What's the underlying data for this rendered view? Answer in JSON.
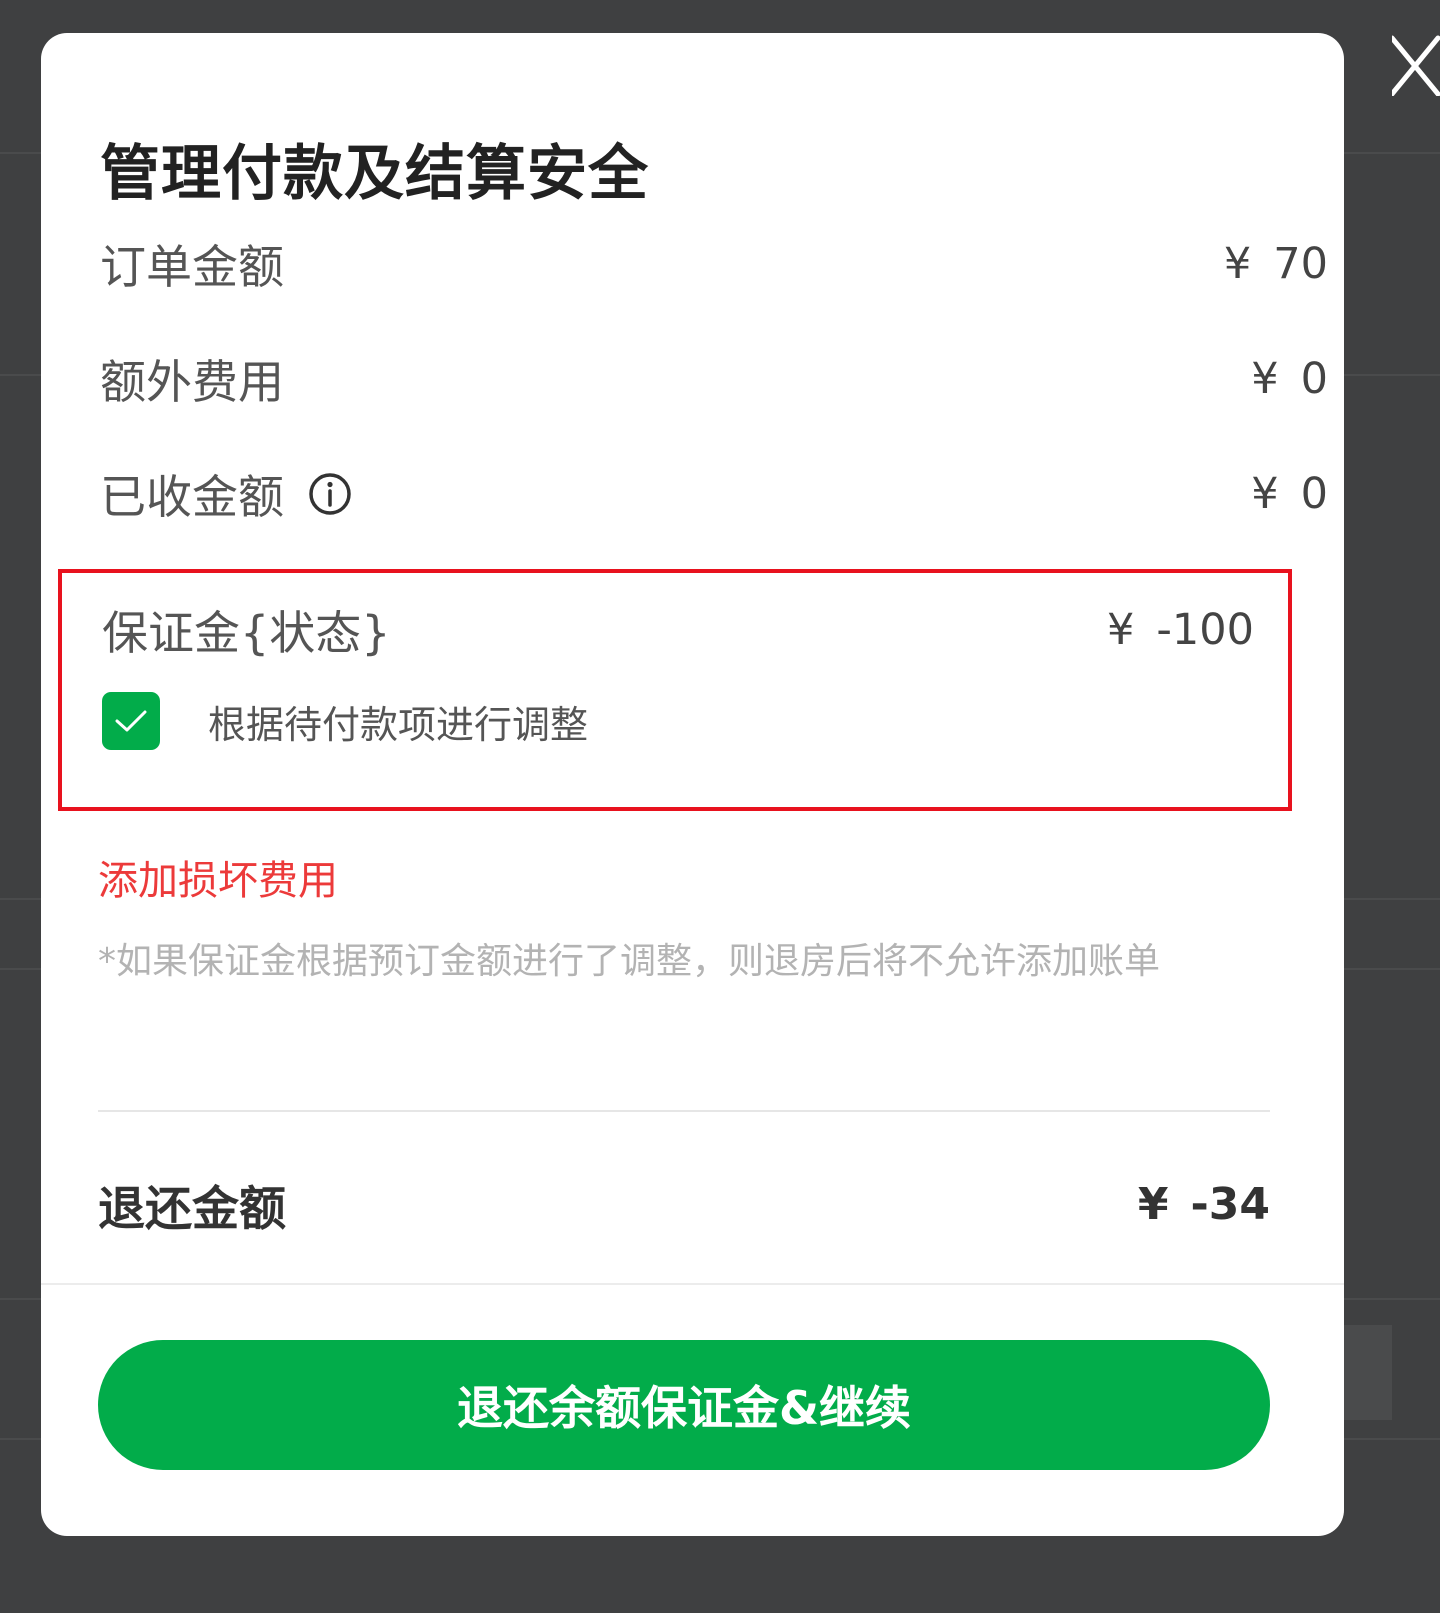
{
  "colors": {
    "overlay": "#3f4041",
    "accent_green": "#02ac4a",
    "highlight_red": "#e8121e",
    "link_red": "#ec3a3a"
  },
  "icons": {
    "close": "close-icon",
    "info": "info-icon",
    "check": "checkmark-icon"
  },
  "dialog": {
    "title": "管理付款及结算安全",
    "rows": [
      {
        "label": "订单金额",
        "currency": "¥",
        "amount": "70"
      },
      {
        "label": "额外费用",
        "currency": "¥",
        "amount": "0"
      },
      {
        "label": "已收金额",
        "currency": "¥",
        "amount": "0"
      }
    ],
    "deposit": {
      "label": "保证金{状态}",
      "currency": "¥",
      "amount": "-100",
      "checkbox_label": "根据待付款项进行调整",
      "checkbox_checked": true
    },
    "add_damage_link": "添加损坏费用",
    "note": "*如果保证金根据预订金额进行了调整，则退房后将不允许添加账单",
    "refund": {
      "label": "退还金额",
      "currency": "¥",
      "amount": "-34"
    },
    "primary_button": "退还余额保证金&继续"
  }
}
